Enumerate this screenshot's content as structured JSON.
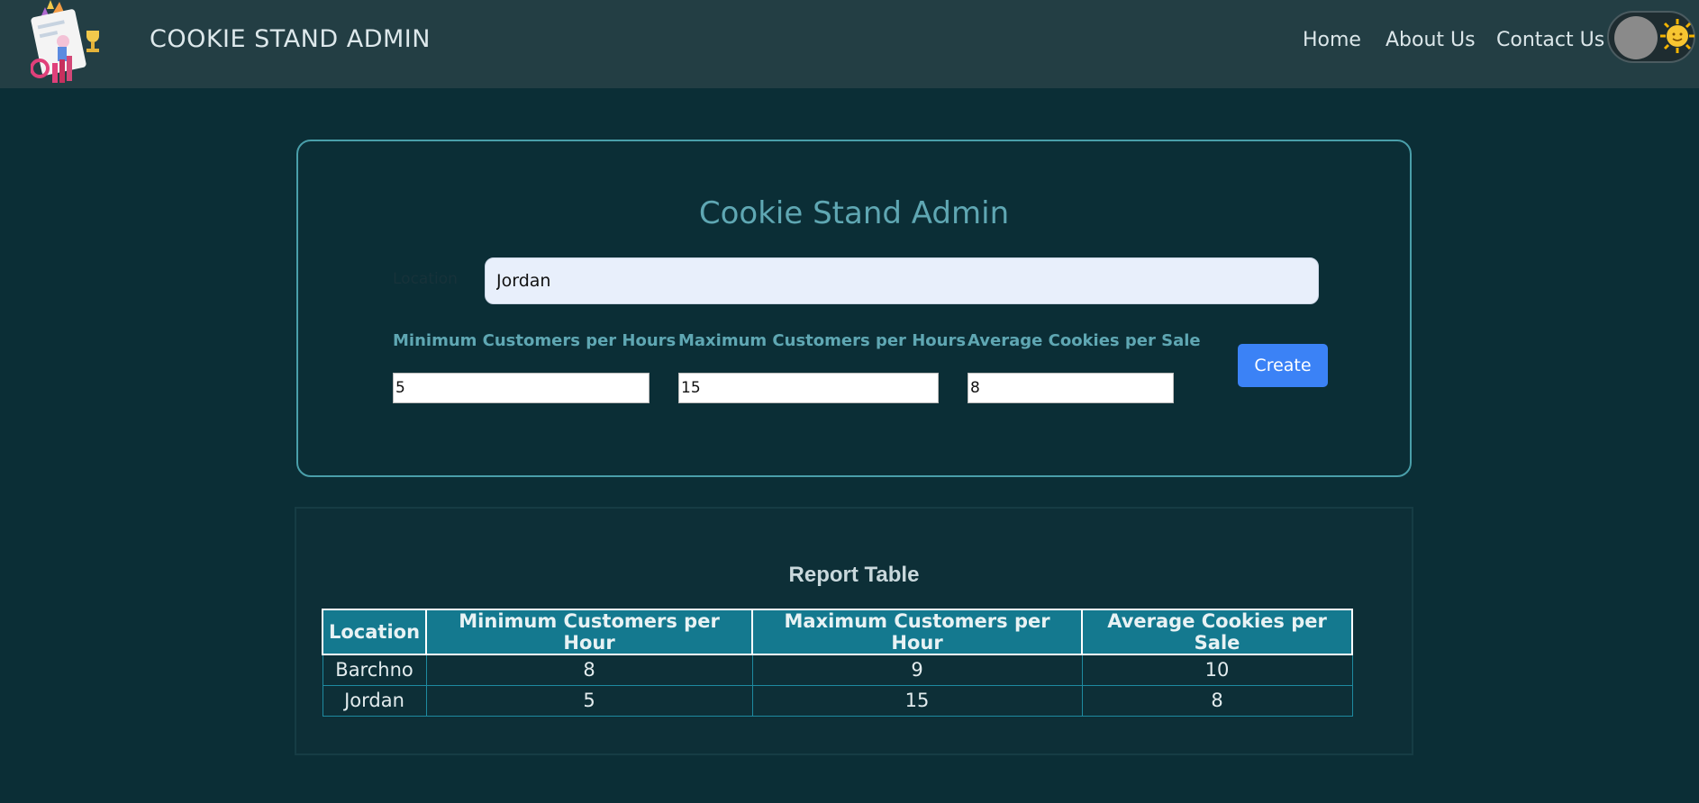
{
  "header": {
    "brand": "COOKIE STAND ADMIN",
    "nav": [
      "Home",
      "About Us",
      "Contact Us"
    ],
    "theme_toggle_icon": "sun-icon"
  },
  "form": {
    "title": "Cookie Stand Admin",
    "location_label": "Location",
    "location_value": "Jordan",
    "min_label": "Minimum Customers per Hours",
    "max_label": "Maximum Customers per Hours",
    "avg_label": "Average Cookies per Sale",
    "min_value": "5",
    "max_value": "15",
    "avg_value": "8",
    "create_label": "Create",
    "button_color": "#3b82f6"
  },
  "report": {
    "title": "Report Table",
    "columns": [
      "Location",
      "Minimum Customers per Hour",
      "Maximum Customers per Hour",
      "Average Cookies per Sale"
    ],
    "rows": [
      [
        "Barchno",
        "8",
        "9",
        "10"
      ],
      [
        "Jordan",
        "5",
        "15",
        "8"
      ]
    ]
  }
}
